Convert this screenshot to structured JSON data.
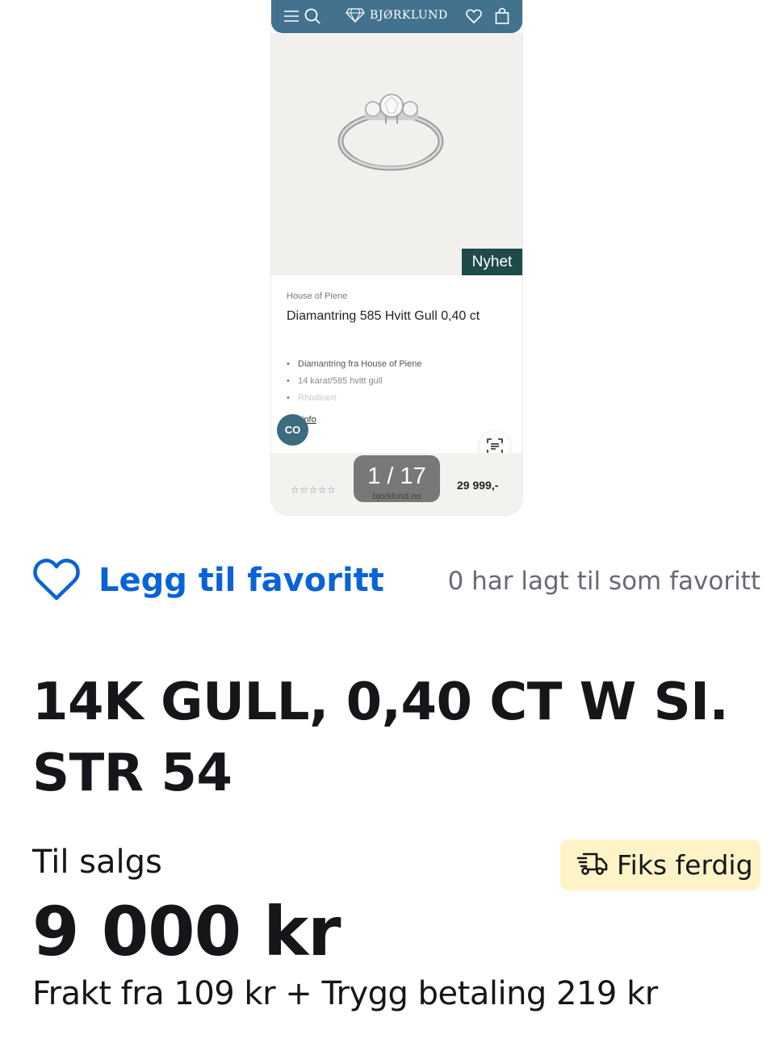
{
  "product_screenshot": {
    "brand": "BJØRKLUND",
    "badge": "Nyhet",
    "maker": "House of Piene",
    "title": "Diamantring 585 Hvitt Gull 0,40 ct",
    "features": [
      "Diamantring fra House of Piene",
      "14 karat/585 hvitt gull",
      "Rhodinert"
    ],
    "info_link": "info",
    "co_button": "CO",
    "stars": "☆☆☆☆☆",
    "price": "29 999,-",
    "image_counter": "1 / 17",
    "image_source": "bjorklund.no",
    "topbar_color": "#43728f",
    "badge_color": "#1f4a4a"
  },
  "favorite": {
    "label": "Legg til favoritt",
    "count_text": "0 har lagt til som favoritt",
    "icon": "heart-outline-icon",
    "accent": "#0963d7"
  },
  "listing": {
    "title": "14K GULL, 0,40 CT W SI. STR 54",
    "status": "Til salgs",
    "shipping_badge": "Fiks ferdig",
    "shipping_badge_icon": "delivery-truck-icon",
    "shipping_badge_color": "#fdf3c6",
    "price": "9 000 kr",
    "shipping_text": "Frakt fra 109 kr + Trygg betaling 219 kr"
  }
}
